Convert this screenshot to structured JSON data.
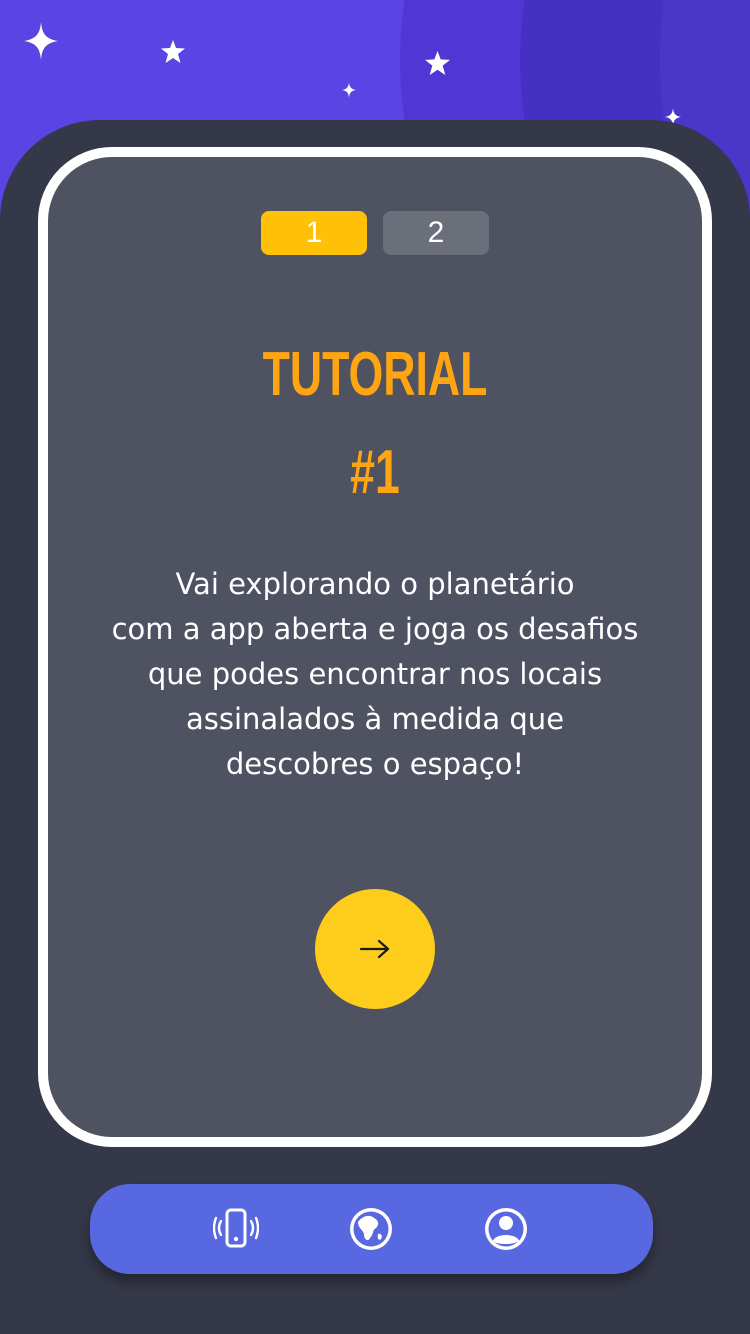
{
  "steps": [
    {
      "label": "1",
      "active": true
    },
    {
      "label": "2",
      "active": false
    }
  ],
  "tutorial": {
    "title": "TUTORIAL",
    "number": "#1",
    "description_lines": [
      "Vai explorando o planetário",
      "com a app aberta e joga os desafios",
      "que podes encontrar nos locais",
      "assinalados à medida que",
      "descobres o espaço!"
    ]
  },
  "next_button": {
    "icon": "arrow-right-icon"
  },
  "bottom_nav": {
    "items": [
      {
        "icon": "phone-vibrate-icon"
      },
      {
        "icon": "globe-icon"
      },
      {
        "icon": "user-profile-icon"
      }
    ]
  },
  "colors": {
    "sky": "#5a44e3",
    "background": "#353848",
    "card": "#4f5261",
    "accent": "#ffc107",
    "title": "#ffa513",
    "button": "#fecc1a",
    "nav": "#5868e0"
  }
}
